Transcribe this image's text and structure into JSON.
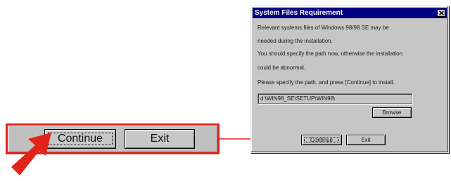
{
  "colors": {
    "highlight_red": "#e2231a",
    "titlebar_blue": "#000080",
    "dialog_face": "#c6c6c6"
  },
  "zoom_strip": {
    "continue_label": "Continue",
    "exit_label": "Exit"
  },
  "dialog": {
    "title": "System Files Requirement",
    "close_icon": "close-x",
    "lines": [
      "Relevant systems files of Windows 98/98 SE may be",
      "needed during the installation.",
      "You should specify the path now, otherwise the installation",
      "could be abnormal.",
      "Please specify the path, and press [Continue] to install."
    ],
    "path_value": "d:\\WIN98_SE\\SETUP\\WIN98\\",
    "browse_label": "Browse",
    "continue_label": "Continue",
    "exit_label": "Exit"
  }
}
